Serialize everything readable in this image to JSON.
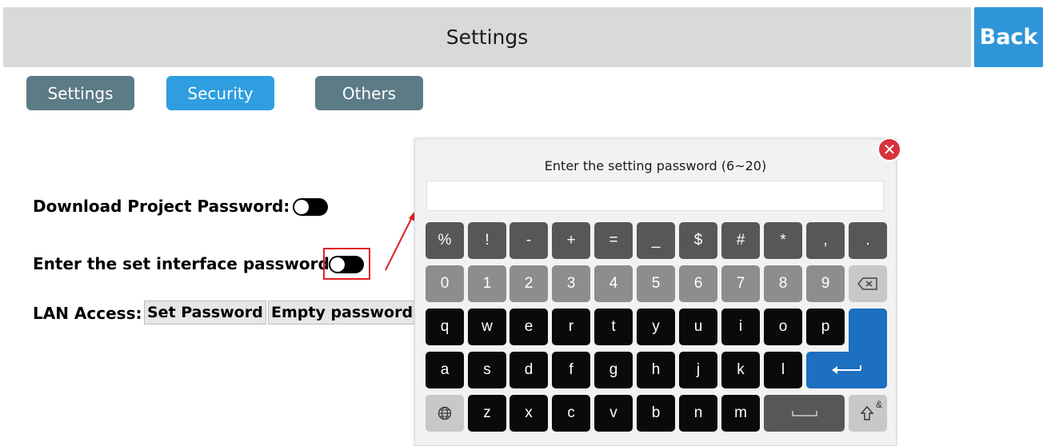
{
  "header": {
    "title": "Settings",
    "back_label": "Back"
  },
  "tabs": [
    {
      "label": "Settings",
      "active": false
    },
    {
      "label": "Security",
      "active": true
    },
    {
      "label": "Others",
      "active": false
    }
  ],
  "security": {
    "download_label": "Download Project Password:",
    "interface_label": "Enter the set interface password:",
    "lan_label": "LAN Access:",
    "set_password_label": "Set Password",
    "empty_password_label": "Empty password"
  },
  "keyboard": {
    "prompt": "Enter the setting password (6~20)",
    "password_value": "",
    "row1": [
      "%",
      "!",
      "-",
      "+",
      "=",
      "_",
      "$",
      "#",
      "*",
      ",",
      "."
    ],
    "row2": [
      "0",
      "1",
      "2",
      "3",
      "4",
      "5",
      "6",
      "7",
      "8",
      "9"
    ],
    "row3": [
      "q",
      "w",
      "e",
      "r",
      "t",
      "y",
      "u",
      "i",
      "o",
      "p"
    ],
    "row4": [
      "a",
      "s",
      "d",
      "f",
      "g",
      "h",
      "j",
      "k",
      "l"
    ],
    "row5": [
      "z",
      "x",
      "c",
      "v",
      "b",
      "n",
      "m"
    ],
    "shift_label": "&"
  },
  "colors": {
    "accent": "#2e96d8",
    "tab_inactive": "#5b7b86",
    "tab_active": "#2e9ee0",
    "enter_key": "#1d6fc0",
    "close": "#d8323a",
    "highlight": "#e02020"
  },
  "icons": [
    "eye-off-icon",
    "clear-icon",
    "close-icon",
    "backspace-icon",
    "enter-icon",
    "globe-icon",
    "space-icon",
    "shift-icon"
  ]
}
